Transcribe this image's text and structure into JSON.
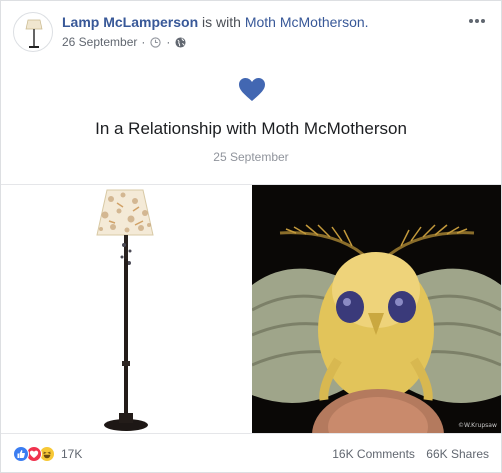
{
  "post": {
    "author": "Lamp McLamperson",
    "with_text": "is with",
    "tagged": "Moth McMotherson.",
    "date": "26 September",
    "separator": "·"
  },
  "event": {
    "title": "In a Relationship with Moth McMotherson",
    "date": "25 September",
    "icon": "heart-icon",
    "icon_color": "#4267b2"
  },
  "photos": {
    "left_subject": "floor lamp",
    "right_subject": "moth",
    "watermark": "©W.Krupsaw"
  },
  "footer": {
    "reaction_icons": [
      "like-icon",
      "love-icon",
      "haha-icon"
    ],
    "reaction_count": "17K",
    "comments": "16K Comments",
    "shares": "66K Shares"
  },
  "colors": {
    "link": "#385898",
    "meta": "#616770",
    "like": "#3b7df1",
    "love": "#f0334f",
    "haha": "#f7c836"
  }
}
